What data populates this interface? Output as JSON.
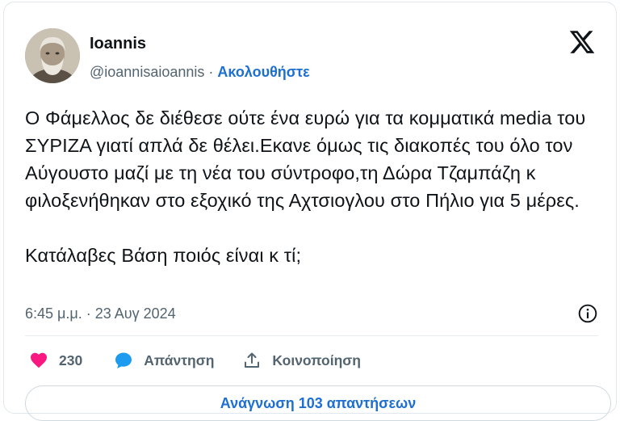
{
  "author": {
    "name": "Ioannis",
    "handle": "@ioannisaioannis",
    "separator": " · ",
    "follow_label": "Ακολουθήστε"
  },
  "tweet": {
    "text": "Ο Φάμελλος δε διέθεσε ούτε ένα ευρώ για τα κομματικά media του ΣΥΡΙΖΑ γιατί απλά δε θέλει.Εκανε όμως τις διακοπές του όλο τον Αύγουστο μαζί με τη νέα του σύντροφο,τη Δώρα Τζαμπάζη κ φιλοξενήθηκαν στο εξοχικό της Αχτσιογλου στο Πήλιο για 5 μέρες.\n\nΚατάλαβες Βάση ποιός είναι κ τί;",
    "timestamp": "6:45 μ.μ. · 23 Αυγ 2024"
  },
  "actions": {
    "likes_count": "230",
    "reply_label": "Απάντηση",
    "share_label": "Κοινοποίηση"
  },
  "footer": {
    "read_replies_label": "Ανάγνωση 103 απαντήσεων"
  },
  "icons": {
    "brand": "x-logo-icon",
    "info": "info-icon",
    "like": "heart-icon",
    "reply": "speech-bubble-icon",
    "share": "share-icon"
  },
  "colors": {
    "like": "#f91880",
    "reply": "#1d9bf0",
    "link": "#1d6fd1",
    "muted": "#536471",
    "text": "#0f1419"
  }
}
